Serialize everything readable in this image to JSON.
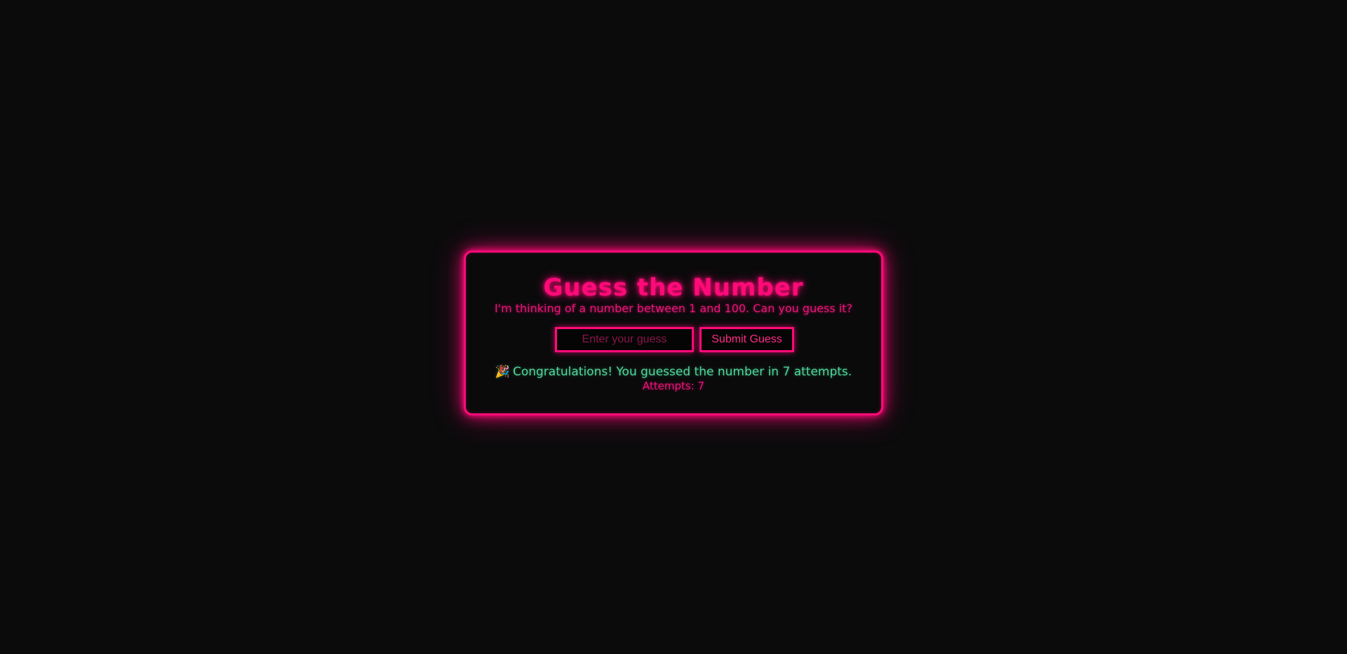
{
  "game": {
    "title": "Guess the Number",
    "subtitle": "I'm thinking of a number between 1 and 100. Can you guess it?",
    "input_placeholder": "Enter your guess",
    "input_value": "",
    "submit_label": "Submit Guess",
    "message_icon": "party-popper-icon",
    "message_emoji": "🎉",
    "message": "Congratulations! You guessed the number in 7 attempts.",
    "attempts_text": "Attempts: 7"
  },
  "colors": {
    "background": "#0b0b0c",
    "neon_pink": "#ff0a78",
    "success_green": "#4fd79a"
  }
}
